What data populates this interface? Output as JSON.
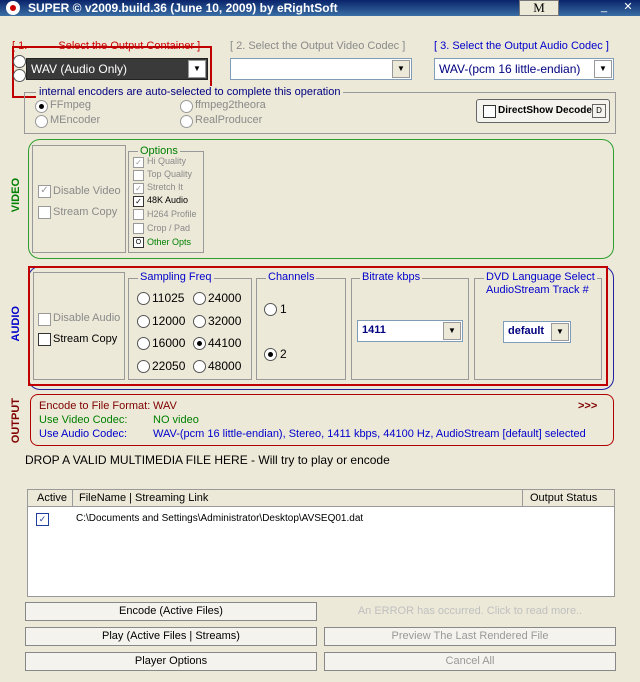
{
  "window": {
    "title": "SUPER © v2009.build.36 (June 10, 2009) by eRightSoft",
    "m_label": "M"
  },
  "step1": {
    "num": "[ 1.",
    "label": "Select the Output Container ]",
    "value": "WAV    (Audio Only)"
  },
  "step2": {
    "label": "[ 2.    Select the Output Video Codec ]",
    "value": ""
  },
  "step3": {
    "label": "[ 3.    Select the Output Audio Codec ]",
    "value": "WAV-(pcm 16 little-endian)"
  },
  "encoders": {
    "note": "internal encoders are auto-selected to complete this operation",
    "items": [
      "FFmpeg",
      "ffmpeg2theora",
      "MEncoder",
      "RealProducer"
    ],
    "directshow": "DirectShow Decode"
  },
  "video": {
    "section_label": "VIDEO",
    "disable_video": "Disable Video",
    "stream_copy": "Stream Copy",
    "options_title": "Options",
    "options": [
      "Hi Quality",
      "Top Quality",
      "Stretch It",
      "48K Audio",
      "H264 Profile",
      "Crop / Pad",
      "Other Opts"
    ]
  },
  "audio": {
    "section_label": "AUDIO",
    "disable_audio": "Disable Audio",
    "stream_copy": "Stream Copy",
    "sampling_title": "Sampling Freq",
    "freqs": [
      "11025",
      "24000",
      "12000",
      "32000",
      "16000",
      "44100",
      "22050",
      "48000"
    ],
    "channels_title": "Channels",
    "channels": [
      "1",
      "2"
    ],
    "bitrate_title": "Bitrate  kbps",
    "bitrate_value": "1411",
    "dvd_title": "DVD Language Select",
    "dvd_sub": "AudioStream  Track #",
    "dvd_value": "default"
  },
  "output": {
    "section_label": "OUTPUT",
    "format_label": "Encode to File Format:",
    "format_value": "WAV",
    "arrows": ">>>",
    "video_label": "Use Video Codec:",
    "video_value": "NO video",
    "audio_label": "Use Audio Codec:",
    "audio_value": "WAV-(pcm 16 little-endian),  Stereo,  1411 kbps,  44100 Hz,  AudioStream [default] selected"
  },
  "drop_text": "DROP A VALID MULTIMEDIA FILE HERE - Will try to play or encode",
  "files": {
    "headers": {
      "active": "Active",
      "filename": "FileName  |  Streaming Link",
      "status": "Output Status"
    },
    "rows": [
      {
        "path": "C:\\Documents and Settings\\Administrator\\Desktop\\AVSEQ01.dat",
        "status": ""
      }
    ]
  },
  "buttons": {
    "encode": "Encode (Active Files)",
    "error": "An ERROR has occurred. Click to read more..",
    "play": "Play (Active Files | Streams)",
    "preview": "Preview The Last Rendered File",
    "player_options": "Player Options",
    "cancel_all": "Cancel All"
  }
}
